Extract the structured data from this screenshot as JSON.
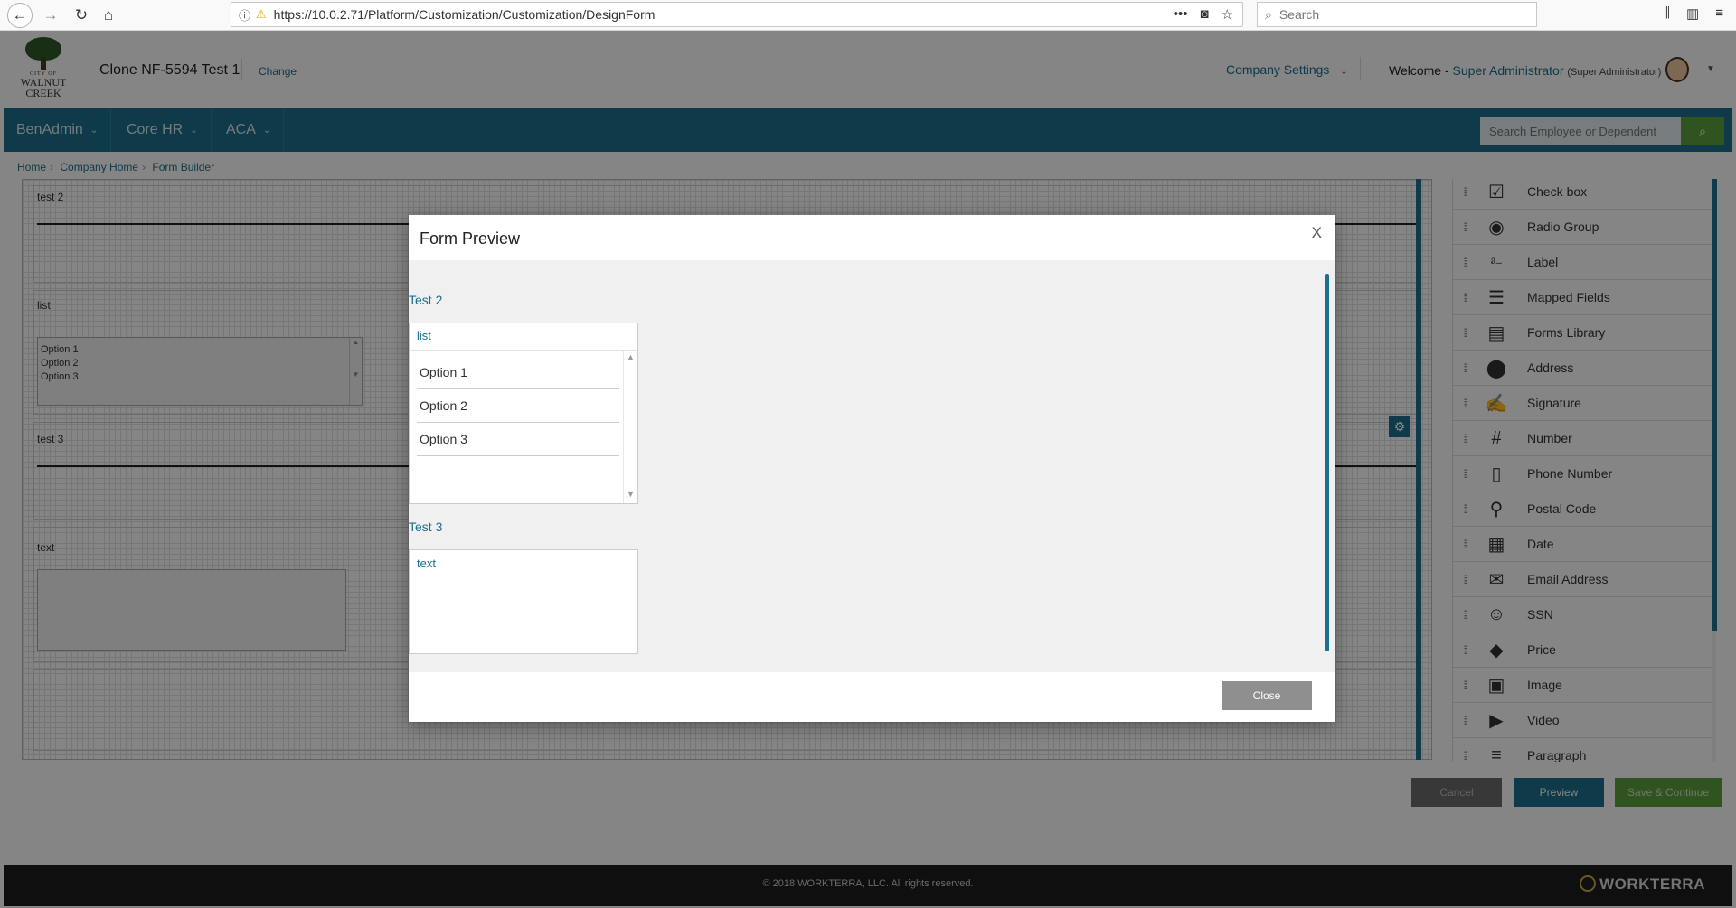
{
  "browser": {
    "url": "https://10.0.2.71/Platform/Customization/Customization/DesignForm",
    "search_placeholder": "Search"
  },
  "header": {
    "logo_city": "CITY OF",
    "logo_line1": "WALNUT",
    "logo_line2": "CREEK",
    "company_name": "Clone NF-5594 Test 1",
    "change_label": "Change",
    "company_settings_label": "Company Settings",
    "welcome_label": "Welcome -",
    "user_name": "Super Administrator",
    "user_role": "(Super Administrator)"
  },
  "nav": {
    "items": [
      {
        "label": "BenAdmin"
      },
      {
        "label": "Core HR"
      },
      {
        "label": "ACA"
      }
    ],
    "search_placeholder": "Search Employee or Dependent"
  },
  "breadcrumb": {
    "items": [
      "Home",
      "Company Home",
      "Form Builder"
    ]
  },
  "canvas": {
    "rows": [
      {
        "label": "test 2"
      },
      {
        "label": "list",
        "options": [
          "Option 1",
          "Option 2",
          "Option 3"
        ]
      },
      {
        "label": "test 3"
      },
      {
        "label": "text"
      }
    ]
  },
  "toolbox": {
    "items": [
      {
        "label": "Check box",
        "icon": "checkbox-icon"
      },
      {
        "label": "Radio Group",
        "icon": "radio-icon"
      },
      {
        "label": "Label",
        "icon": "label-icon"
      },
      {
        "label": "Mapped Fields",
        "icon": "mapped-fields-icon"
      },
      {
        "label": "Forms Library",
        "icon": "forms-library-icon"
      },
      {
        "label": "Address",
        "icon": "map-pin-icon"
      },
      {
        "label": "Signature",
        "icon": "signature-icon"
      },
      {
        "label": "Number",
        "icon": "hash-icon"
      },
      {
        "label": "Phone Number",
        "icon": "phone-icon"
      },
      {
        "label": "Postal Code",
        "icon": "postal-pin-icon"
      },
      {
        "label": "Date",
        "icon": "calendar-icon"
      },
      {
        "label": "Email Address",
        "icon": "envelope-icon"
      },
      {
        "label": "SSN",
        "icon": "person-icon"
      },
      {
        "label": "Price",
        "icon": "tag-icon"
      },
      {
        "label": "Image",
        "icon": "image-icon"
      },
      {
        "label": "Video",
        "icon": "video-icon"
      },
      {
        "label": "Paragraph",
        "icon": "paragraph-icon"
      }
    ]
  },
  "actions": {
    "cancel": "Cancel",
    "preview": "Preview",
    "save": "Save & Continue"
  },
  "modal": {
    "title": "Form Preview",
    "close_x": "X",
    "fields": [
      {
        "label": "Test 2",
        "type": "list",
        "header": "list",
        "options": [
          "Option 1",
          "Option 2",
          "Option 3"
        ]
      },
      {
        "label": "Test 3",
        "type": "text",
        "value": "text"
      }
    ],
    "close_button": "Close"
  },
  "footer": {
    "copyright": "© 2018 WORKTERRA, LLC. All rights reserved.",
    "brand": "WORKTERRA"
  },
  "colors": {
    "primary": "#1b6f8f",
    "success": "#5aa13c",
    "footer_bg": "#1d1d1d"
  }
}
